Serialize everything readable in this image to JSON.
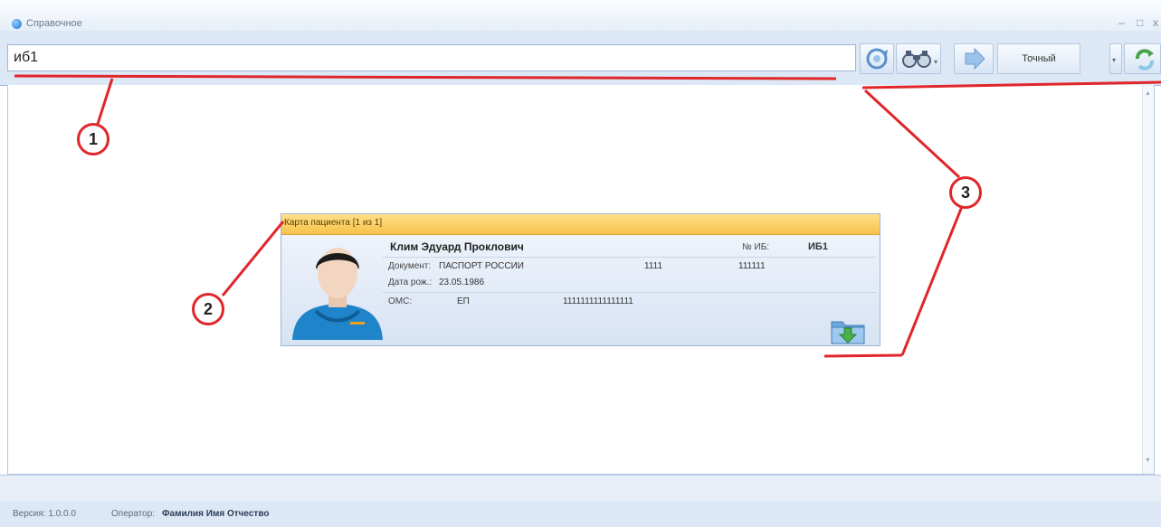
{
  "window": {
    "title": "Справочное",
    "minimize": "–",
    "maximize": "□",
    "close": "x"
  },
  "search": {
    "query": "иб1"
  },
  "toolbar": {
    "mode_label": "Точный"
  },
  "card": {
    "header": "Карта пациента [1 из 1]",
    "patient_name": "Клим Эдуард Проклович",
    "ib_label": "№ ИБ:",
    "ib_value": "ИБ1",
    "document_label": "Документ:",
    "document_type": "ПАСПОРТ РОССИИ",
    "document_series": "1111",
    "document_number": "111111",
    "birth_label": "Дата рож.:",
    "birth_date": "23.05.1986",
    "oms_label": "ОМС:",
    "oms_type": "ЕП",
    "oms_number": "1111111111111111"
  },
  "annotations": {
    "marker1": "1",
    "marker2": "2",
    "marker3": "3"
  },
  "status": {
    "version_label": "Версия: 1.0.0.0",
    "operator_label": "Оператор:",
    "operator_name": "Фамилия Имя Отчество"
  },
  "colors": {
    "annotation": "#e0262b",
    "card_header": "#f6c24a",
    "panel": "#dce8f6"
  }
}
